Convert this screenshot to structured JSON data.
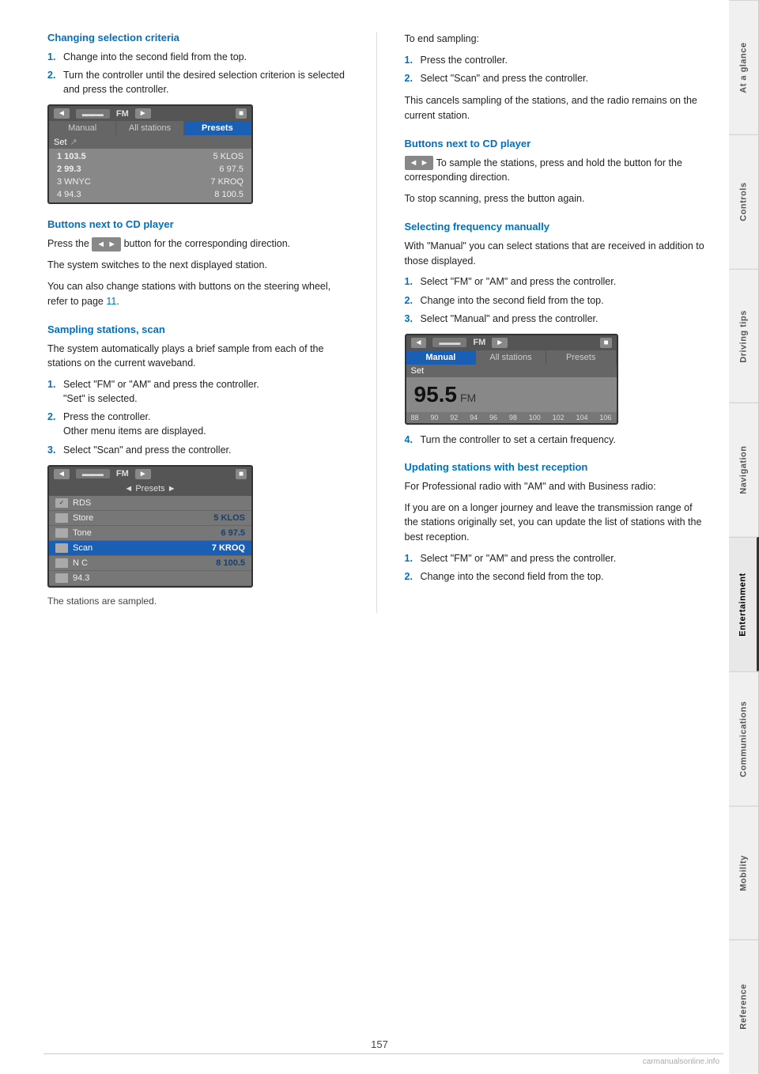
{
  "page": {
    "number": "157"
  },
  "sidebar": {
    "tabs": [
      {
        "id": "at-a-glance",
        "label": "At a glance",
        "active": false
      },
      {
        "id": "controls",
        "label": "Controls",
        "active": false
      },
      {
        "id": "driving-tips",
        "label": "Driving tips",
        "active": false
      },
      {
        "id": "navigation",
        "label": "Navigation",
        "active": false
      },
      {
        "id": "entertainment",
        "label": "Entertainment",
        "active": true
      },
      {
        "id": "communications",
        "label": "Communications",
        "active": false
      },
      {
        "id": "mobility",
        "label": "Mobility",
        "active": false
      },
      {
        "id": "reference",
        "label": "Reference",
        "active": false
      }
    ]
  },
  "left_column": {
    "section1": {
      "heading": "Changing selection criteria",
      "steps": [
        {
          "num": "1.",
          "text": "Change into the second field from the top."
        },
        {
          "num": "2.",
          "text": "Turn the controller until the desired selection criterion is selected and press the controller."
        }
      ]
    },
    "screen1": {
      "topbar": {
        "left_arrow": "◄",
        "icon": "▬",
        "label": "FM",
        "right_arrow": "►",
        "corner": "■"
      },
      "tabs": [
        {
          "label": "Manual",
          "type": "normal"
        },
        {
          "label": "All stations",
          "type": "normal"
        },
        {
          "label": "Presets",
          "type": "highlighted"
        }
      ],
      "set_row": "Set",
      "stations": [
        {
          "left": "1  103.5",
          "right": "5 KLOS",
          "highlight": false
        },
        {
          "left": "2  99.3",
          "right": "6  97.5",
          "highlight": false
        },
        {
          "left": "3 WNYC",
          "right": "7 KROQ",
          "highlight": false
        },
        {
          "left": "4  94.3",
          "right": "8  100.5",
          "highlight": false
        }
      ]
    },
    "section2": {
      "heading": "Buttons next to CD player",
      "para1": "Press the",
      "button_label": "◄►",
      "para1b": "button for the corresponding direction.",
      "para2": "The system switches to the next displayed station.",
      "para3": "You can also change stations with buttons on the steering wheel, refer to page",
      "page_link": "11",
      "para3b": "."
    },
    "section3": {
      "heading": "Sampling stations, scan",
      "para1": "The system automatically plays a brief sample from each of the stations on the current waveband.",
      "steps": [
        {
          "num": "1.",
          "text": "Select \"FM\" or \"AM\" and press the controller.\n\"Set\" is selected."
        },
        {
          "num": "2.",
          "text": "Press the controller.\nOther menu items are displayed."
        },
        {
          "num": "3.",
          "text": "Select \"Scan\" and press the controller."
        }
      ]
    },
    "screen2": {
      "topbar_label": "FM",
      "presets_bar": "◄ Presets ►",
      "menu_items": [
        {
          "icon": "✓",
          "label": "RDS",
          "right": "",
          "selected": false
        },
        {
          "icon": "",
          "label": "Store",
          "right": "5 KLOS",
          "selected": false
        },
        {
          "icon": "",
          "label": "Tone",
          "right": "6  97.5",
          "selected": false
        },
        {
          "icon": "",
          "label": "Scan",
          "right": "7 KROQ",
          "selected": true
        },
        {
          "icon": "",
          "label": "N C",
          "right": "8  100.5",
          "selected": false
        },
        {
          "icon": "",
          "label": "  94.3",
          "right": "",
          "selected": false
        }
      ]
    },
    "caption1": "The stations are sampled."
  },
  "right_column": {
    "to_end_sampling": {
      "heading": "To end sampling:",
      "steps": [
        {
          "num": "1.",
          "text": "Press the controller."
        },
        {
          "num": "2.",
          "text": "Select \"Scan\" and press the controller."
        }
      ],
      "para1": "This cancels sampling of the stations, and the radio remains on the current station."
    },
    "section_buttons_cd": {
      "heading": "Buttons next to CD player",
      "para1": "To sample the stations, press and hold the button for the corresponding direction.",
      "para2": "To stop scanning, press the button again."
    },
    "section_freq": {
      "heading": "Selecting frequency manually",
      "para1": "With \"Manual\" you can select stations that are received in addition to those displayed.",
      "steps": [
        {
          "num": "1.",
          "text": "Select \"FM\" or \"AM\" and press the controller."
        },
        {
          "num": "2.",
          "text": "Change into the second field from the top."
        },
        {
          "num": "3.",
          "text": "Select \"Manual\" and press the controller."
        }
      ]
    },
    "screen3": {
      "topbar": {
        "left_arrow": "◄",
        "icon": "▬",
        "label": "FM",
        "right_arrow": "►",
        "corner": "■"
      },
      "tabs": [
        {
          "label": "Manual",
          "type": "highlighted"
        },
        {
          "label": "All stations",
          "type": "normal"
        },
        {
          "label": "Presets",
          "type": "normal"
        }
      ],
      "set_row": "Set",
      "freq_big": "95.5",
      "freq_unit": "FM",
      "scale_labels": [
        "88",
        "90",
        "92",
        "94",
        "96",
        "98",
        "100",
        "102",
        "104",
        "106"
      ]
    },
    "step4": {
      "num": "4.",
      "text": "Turn the controller to set a certain frequency."
    },
    "section_update": {
      "heading": "Updating stations with best reception",
      "para1": "For Professional radio with \"AM\" and with Business radio:",
      "para2": "If you are on a longer journey and leave the transmission range of the stations originally set, you can update the list of stations with the best reception.",
      "steps": [
        {
          "num": "1.",
          "text": "Select \"FM\" or \"AM\" and press the controller."
        },
        {
          "num": "2.",
          "text": "Change into the second field from the top."
        }
      ]
    }
  }
}
